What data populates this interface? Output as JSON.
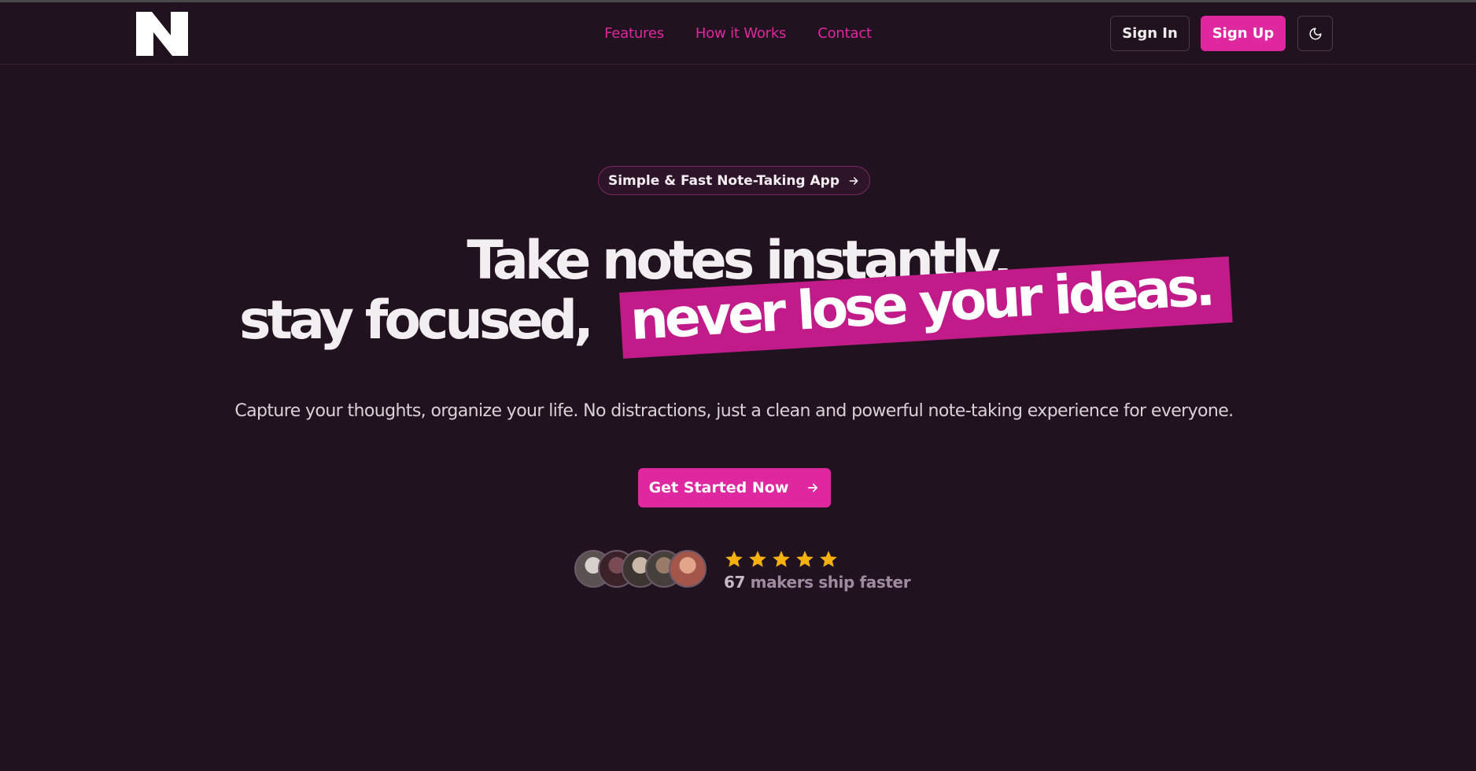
{
  "nav": {
    "logo_icon": "n-logo-icon",
    "links": [
      "Features",
      "How it Works",
      "Contact"
    ],
    "sign_in": "Sign In",
    "sign_up": "Sign Up",
    "theme_icon": "moon-icon"
  },
  "hero": {
    "pill_text": "Simple & Fast Note-Taking App",
    "title_line1": "Take notes instantly,",
    "title_line2": "stay focused,",
    "title_highlight": "never lose your ideas.",
    "subtitle": "Capture your thoughts, organize your life. No distractions, just a clean and powerful note-taking experience for everyone.",
    "cta_label": "Get Started Now"
  },
  "social_proof": {
    "rating": 5,
    "count": "67",
    "text": "makers ship faster"
  },
  "colors": {
    "background": "#21121f",
    "accent": "#df279f",
    "highlight": "#c01b88",
    "star": "#f5b10f"
  }
}
